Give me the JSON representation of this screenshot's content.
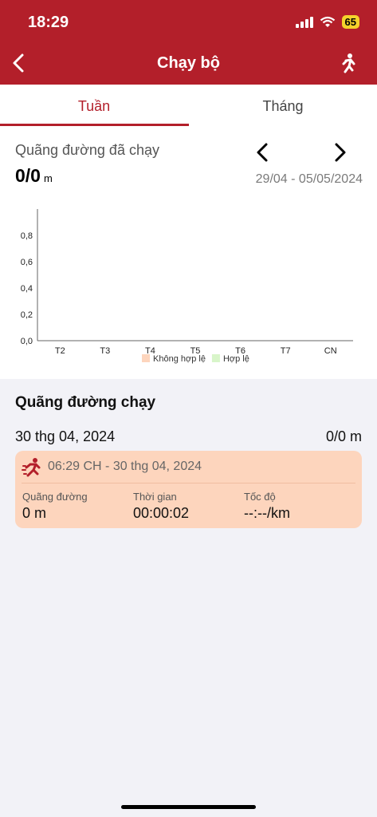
{
  "status_bar": {
    "time": "18:29",
    "battery": "65"
  },
  "header": {
    "title": "Chạy bộ"
  },
  "tabs": [
    {
      "label": "Tuần"
    },
    {
      "label": "Tháng"
    }
  ],
  "summary": {
    "label": "Quãng đường đã chạy",
    "value": "0/0",
    "unit": "m",
    "date_range": "29/04 - 05/05/2024"
  },
  "chart_data": {
    "type": "bar",
    "categories": [
      "T2",
      "T3",
      "T4",
      "T5",
      "T6",
      "T7",
      "CN"
    ],
    "series": [
      {
        "name": "Không hợp lệ",
        "values": [
          0,
          0,
          0,
          0,
          0,
          0,
          0
        ]
      },
      {
        "name": "Hợp lệ",
        "values": [
          0,
          0,
          0,
          0,
          0,
          0,
          0
        ]
      }
    ],
    "yticks": [
      "0,0",
      "0,2",
      "0,4",
      "0,6",
      "0,8"
    ],
    "ylim": [
      0,
      1
    ],
    "legend": "bottom",
    "colors": {
      "Không hợp lệ": "#fdd5bd",
      "Hợp lệ": "#d8f5c9"
    }
  },
  "list": {
    "title": "Quãng đường chạy",
    "day": {
      "date": "30 thg 04, 2024",
      "total": "0/0 m"
    },
    "entries": [
      {
        "time": "06:29 CH - 30 thg 04, 2024",
        "distance_label": "Quãng đường",
        "distance_value": "0 m",
        "duration_label": "Thời gian",
        "duration_value": "00:00:02",
        "pace_label": "Tốc độ",
        "pace_value": "--:--/km"
      }
    ]
  },
  "colors": {
    "brand": "#b31f2a",
    "card": "#fdd5bd"
  }
}
